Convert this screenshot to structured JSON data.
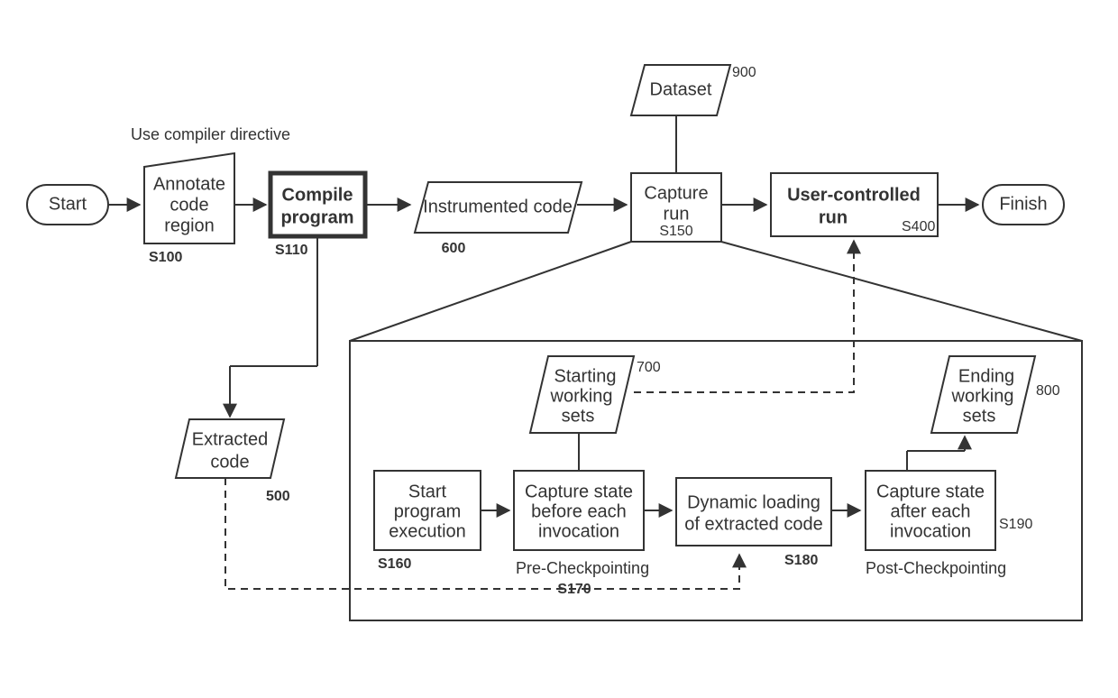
{
  "annotation": "Use compiler directive",
  "nodes": {
    "start": "Start",
    "annotate1": "Annotate",
    "annotate2": "code",
    "annotate3": "region",
    "annotate_ref": "S100",
    "compile1": "Compile",
    "compile2": "program",
    "compile_ref": "S110",
    "instr": "Instrumented code",
    "instr_ref": "600",
    "capture1": "Capture",
    "capture2": "run",
    "capture_ref": "S150",
    "user1": "User-controlled",
    "user2": "run",
    "user_ref": "S400",
    "finish": "Finish",
    "dataset": "Dataset",
    "dataset_ref": "900",
    "extracted1": "Extracted",
    "extracted2": "code",
    "extracted_ref": "500",
    "sws1": "Starting",
    "sws2": "working",
    "sws3": "sets",
    "sws_ref": "700",
    "ews1": "Ending",
    "ews2": "working",
    "ews3": "sets",
    "ews_ref": "800",
    "startexec1": "Start",
    "startexec2": "program",
    "startexec3": "execution",
    "startexec_ref": "S160",
    "cbefore1": "Capture state",
    "cbefore2": "before each",
    "cbefore3": "invocation",
    "cbefore_ref": "S170",
    "precheckpoint": "Pre-Checkpointing",
    "dynload1": "Dynamic loading",
    "dynload2": "of extracted code",
    "dynload_ref": "S180",
    "cafter1": "Capture state",
    "cafter2": "after each",
    "cafter3": "invocation",
    "cafter_ref": "S190",
    "postcheckpoint": "Post-Checkpointing"
  }
}
